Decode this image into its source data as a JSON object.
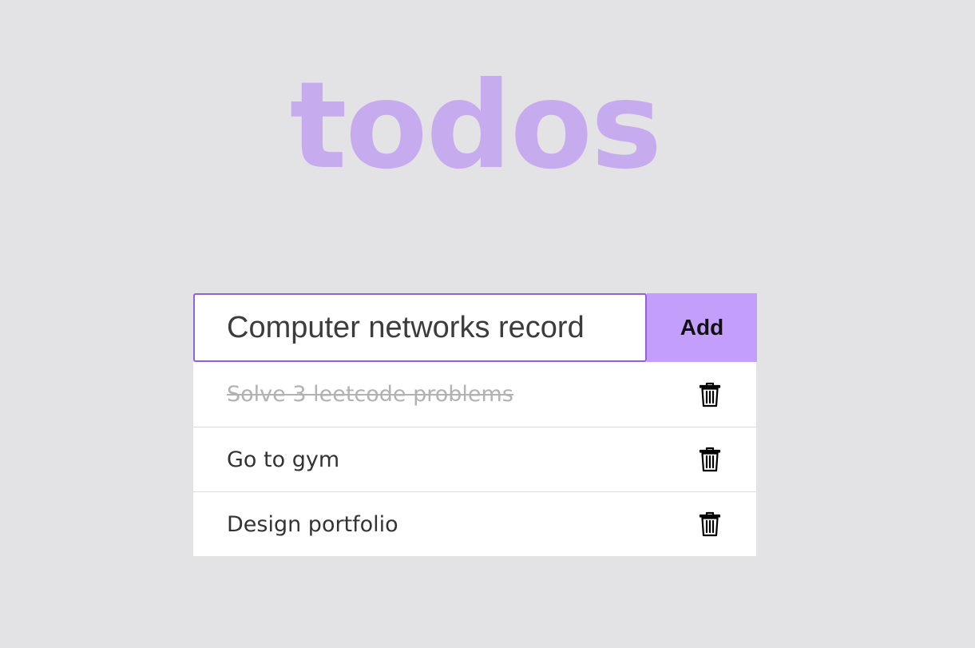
{
  "app": {
    "title": "todos"
  },
  "new_todo": {
    "value": "Computer networks record",
    "add_label": "Add"
  },
  "todos": [
    {
      "text": "Solve 3 leetcode problems",
      "completed": true,
      "delete_icon": "trash-icon"
    },
    {
      "text": "Go to gym",
      "completed": false,
      "delete_icon": "trash-icon"
    },
    {
      "text": "Design portfolio",
      "completed": false,
      "delete_icon": "trash-icon"
    }
  ],
  "colors": {
    "background": "#e3e2e4",
    "title": "#c6acee",
    "accent": "#c39ffb",
    "input_border": "#8f63d8",
    "completed_text": "#b2b2b2"
  }
}
